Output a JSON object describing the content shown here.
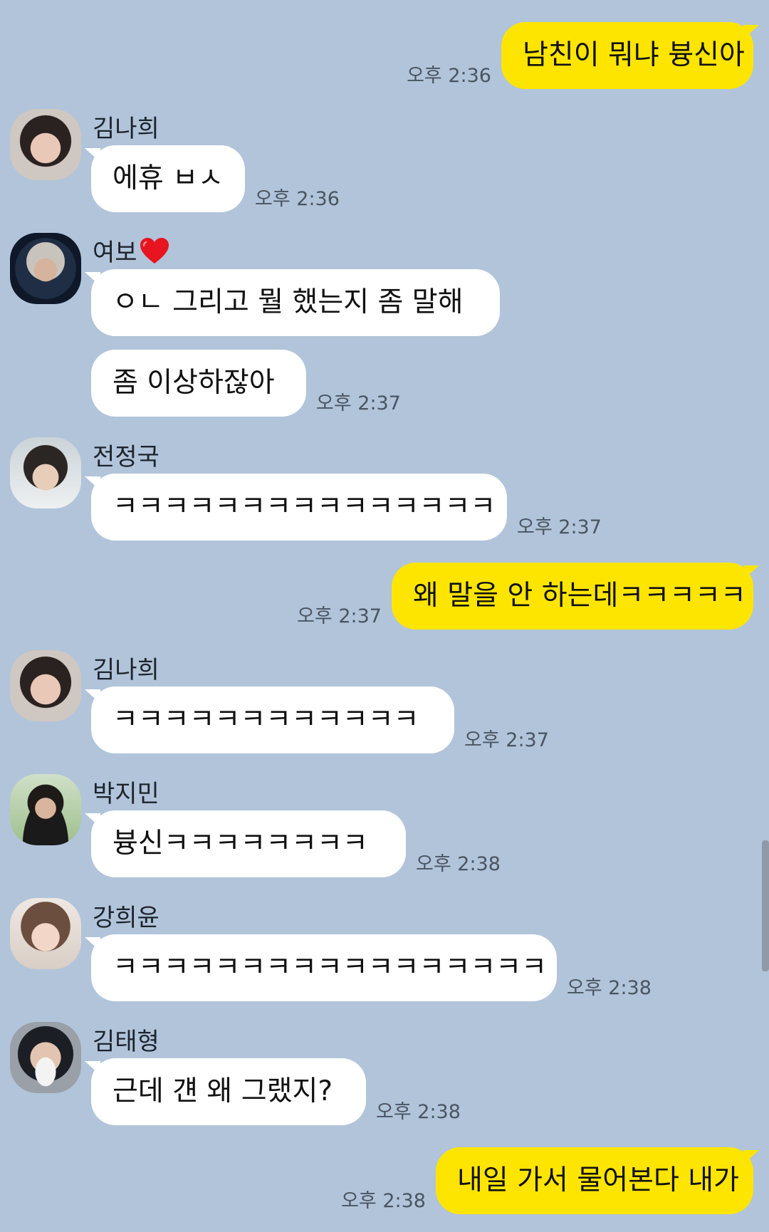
{
  "messages": [
    {
      "type": "out",
      "text": "남친이 뭐냐 븅신아",
      "time": "오후 2:36"
    },
    {
      "type": "in",
      "sender": "김나희",
      "texts": [
        "에휴 ㅂㅅ"
      ],
      "time": "오후 2:36"
    },
    {
      "type": "in",
      "sender": "여보",
      "texts": [
        "ㅇㄴ 그리고 뭘 했는지 좀 말해",
        "좀 이상하잖아"
      ],
      "time": "오후 2:37"
    },
    {
      "type": "in",
      "sender": "전정국",
      "texts": [
        "ㅋㅋㅋㅋㅋㅋㅋㅋㅋㅋㅋㅋㅋㅋㅋ"
      ],
      "time": "오후 2:37"
    },
    {
      "type": "out",
      "text": "왜 말을 안 하는데ㅋㅋㅋㅋㅋ",
      "time": "오후 2:37"
    },
    {
      "type": "in",
      "sender": "김나희",
      "texts": [
        "ㅋㅋㅋㅋㅋㅋㅋㅋㅋㅋㅋㅋ"
      ],
      "time": "오후 2:37"
    },
    {
      "type": "in",
      "sender": "박지민",
      "texts": [
        "븅신ㅋㅋㅋㅋㅋㅋㅋㅋ"
      ],
      "time": "오후 2:38"
    },
    {
      "type": "in",
      "sender": "강희윤",
      "texts": [
        "ㅋㅋㅋㅋㅋㅋㅋㅋㅋㅋㅋㅋㅋㅋㅋㅋㅋ"
      ],
      "time": "오후 2:38"
    },
    {
      "type": "in",
      "sender": "김태형",
      "texts": [
        "근데 걘 왜 그랬지?"
      ],
      "time": "오후 2:38"
    },
    {
      "type": "out",
      "text": "내일 가서 물어본다 내가",
      "time": "오후 2:38"
    }
  ],
  "colors": {
    "background": "#b1c4da",
    "out_bubble": "#fee500",
    "in_bubble": "#ffffff"
  },
  "icons": {
    "heart": "red-heart-icon"
  }
}
